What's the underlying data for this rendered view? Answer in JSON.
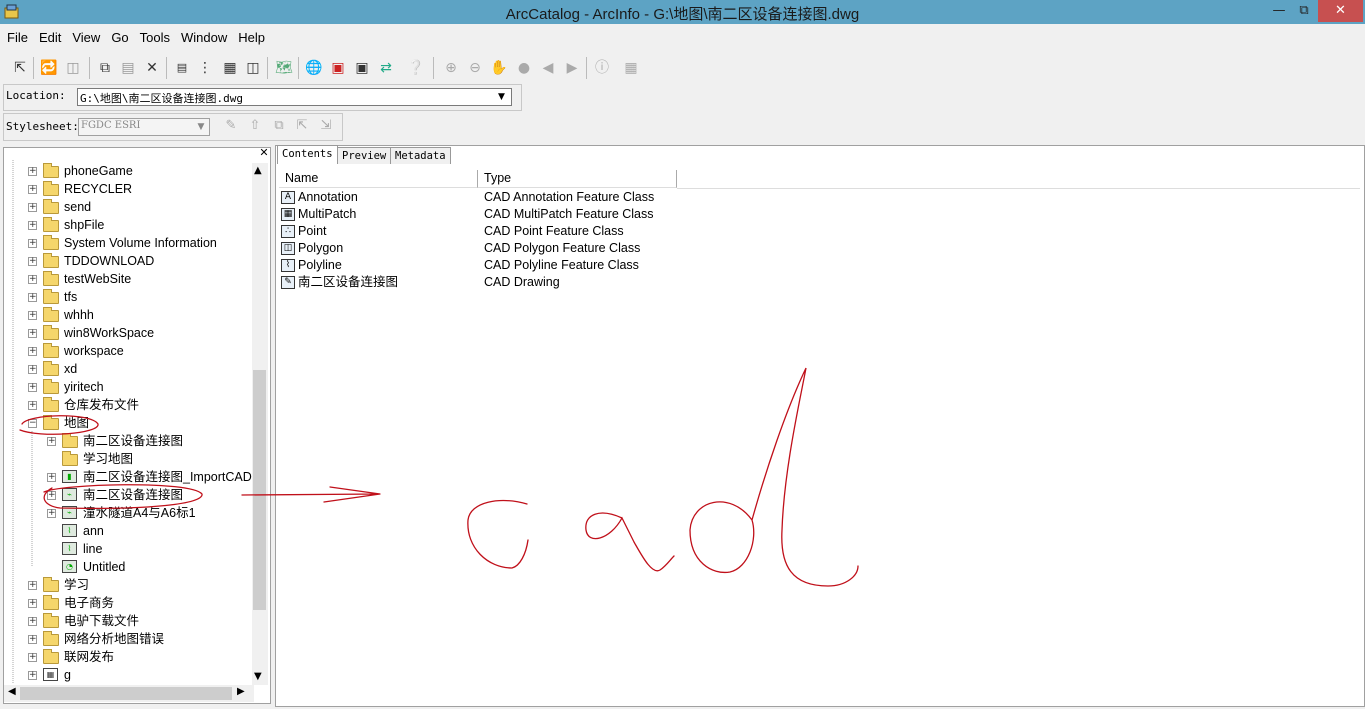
{
  "window": {
    "title": "ArcCatalog - ArcInfo - G:\\地图\\南二区设备连接图.dwg"
  },
  "menu": [
    "File",
    "Edit",
    "View",
    "Go",
    "Tools",
    "Window",
    "Help"
  ],
  "location": {
    "label": "Location:",
    "value": "G:\\地图\\南二区设备连接图.dwg"
  },
  "stylesheet": {
    "label": "Stylesheet:",
    "value": "FGDC ESRI"
  },
  "tree": {
    "items": [
      {
        "label": "phoneGame",
        "depth": 0,
        "type": "folder"
      },
      {
        "label": "RECYCLER",
        "depth": 0,
        "type": "folder"
      },
      {
        "label": "send",
        "depth": 0,
        "type": "folder"
      },
      {
        "label": "shpFile",
        "depth": 0,
        "type": "folder"
      },
      {
        "label": "System Volume Information",
        "depth": 0,
        "type": "folder"
      },
      {
        "label": "TDDOWNLOAD",
        "depth": 0,
        "type": "folder"
      },
      {
        "label": "testWebSite",
        "depth": 0,
        "type": "folder"
      },
      {
        "label": "tfs",
        "depth": 0,
        "type": "folder"
      },
      {
        "label": "whhh",
        "depth": 0,
        "type": "folder"
      },
      {
        "label": "win8WorkSpace",
        "depth": 0,
        "type": "folder"
      },
      {
        "label": "workspace",
        "depth": 0,
        "type": "folder"
      },
      {
        "label": "xd",
        "depth": 0,
        "type": "folder"
      },
      {
        "label": "yiritech",
        "depth": 0,
        "type": "folder"
      },
      {
        "label": "仓库发布文件",
        "depth": 0,
        "type": "folder"
      },
      {
        "label": "地图",
        "depth": 0,
        "type": "folder",
        "expanded": true
      },
      {
        "label": "南二区设备连接图",
        "depth": 1,
        "type": "folder"
      },
      {
        "label": "学习地图",
        "depth": 1,
        "type": "folder",
        "noexp": true
      },
      {
        "label": "南二区设备连接图_ImportCAD",
        "depth": 1,
        "type": "db"
      },
      {
        "label": "南二区设备连接图",
        "depth": 1,
        "type": "cad"
      },
      {
        "label": "潼水隧道A4与A6标1",
        "depth": 1,
        "type": "cad"
      },
      {
        "label": "ann",
        "depth": 1,
        "type": "shp",
        "noexp": true
      },
      {
        "label": "line",
        "depth": 1,
        "type": "shp",
        "noexp": true
      },
      {
        "label": "Untitled",
        "depth": 1,
        "type": "mxd",
        "noexp": true
      },
      {
        "label": "学习",
        "depth": 0,
        "type": "folder"
      },
      {
        "label": "电子商务",
        "depth": 0,
        "type": "folder"
      },
      {
        "label": "电驴下载文件",
        "depth": 0,
        "type": "folder"
      },
      {
        "label": "网络分析地图错误",
        "depth": 0,
        "type": "folder"
      },
      {
        "label": "联网发布",
        "depth": 0,
        "type": "folder"
      },
      {
        "label": "g",
        "depth": 0,
        "type": "grid"
      }
    ]
  },
  "tabs": [
    "Contents",
    "Preview",
    "Metadata"
  ],
  "columns": {
    "name": "Name",
    "type": "Type"
  },
  "contents": [
    {
      "name": "Annotation",
      "type": "CAD Annotation Feature Class",
      "icon": "A"
    },
    {
      "name": "MultiPatch",
      "type": "CAD MultiPatch Feature Class",
      "icon": "▦"
    },
    {
      "name": "Point",
      "type": "CAD Point Feature Class",
      "icon": "∴"
    },
    {
      "name": "Polygon",
      "type": "CAD Polygon Feature Class",
      "icon": "◫"
    },
    {
      "name": "Polyline",
      "type": "CAD Polyline Feature Class",
      "icon": "⌇"
    },
    {
      "name": "南二区设备连接图",
      "type": "CAD Drawing",
      "icon": "✎"
    }
  ],
  "colors": {
    "annotation": "#c0101a",
    "titlebar": "#5da3c4"
  }
}
